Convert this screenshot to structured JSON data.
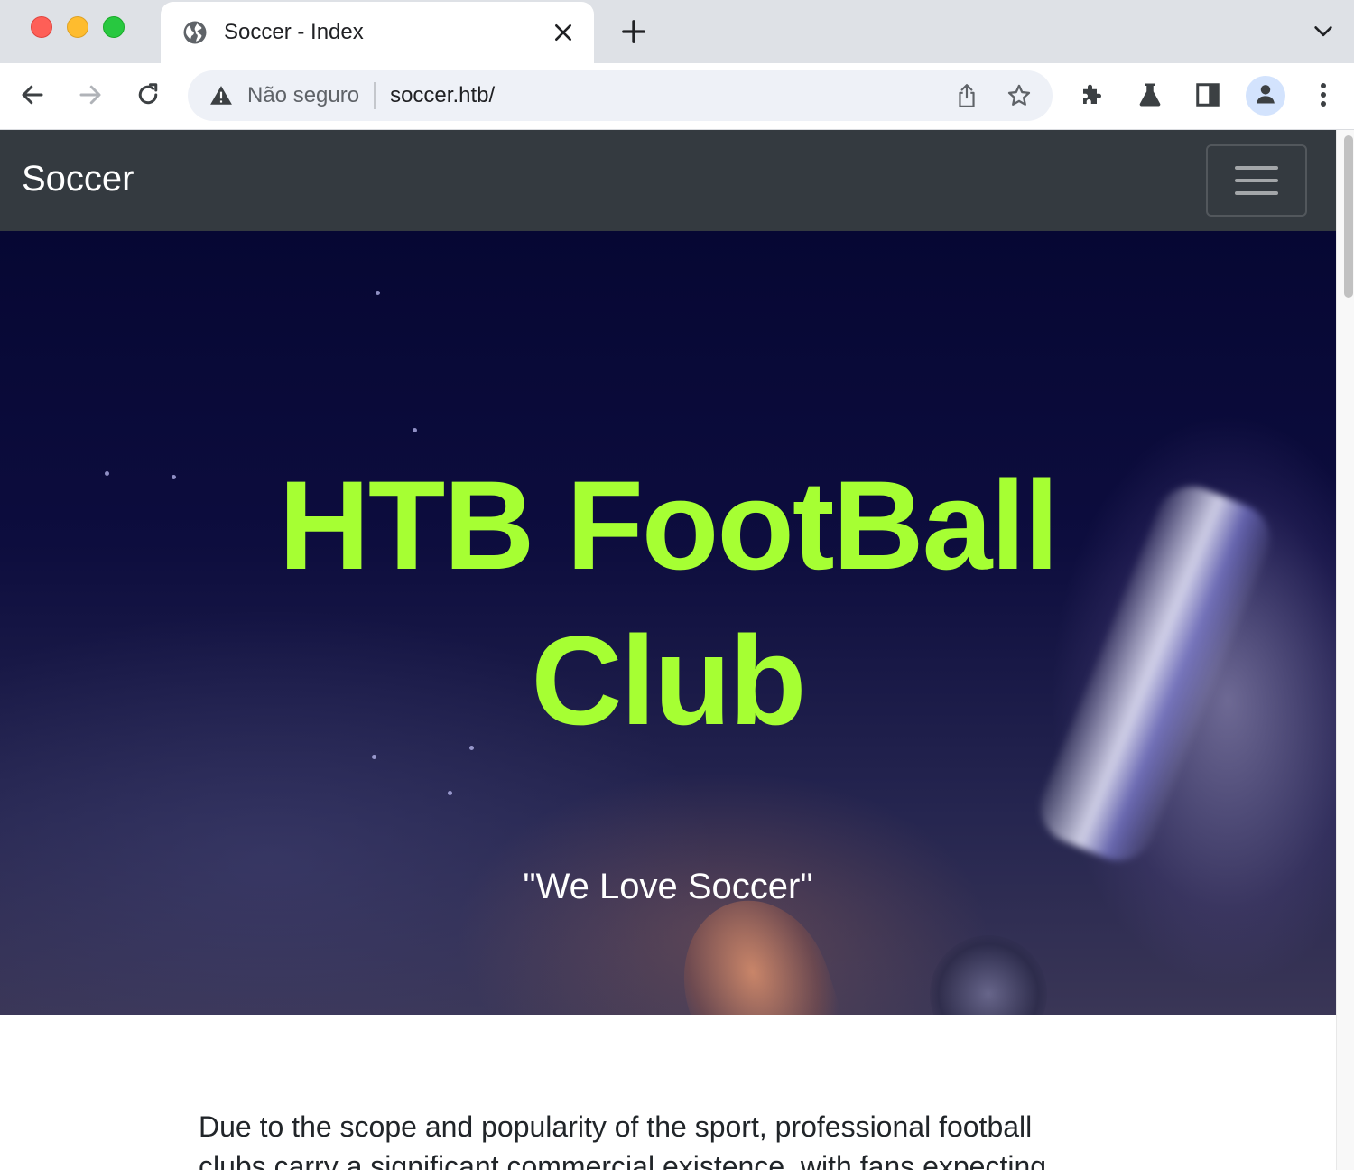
{
  "browser": {
    "tab": {
      "title": "Soccer - Index",
      "favicon": "globe-icon"
    },
    "omnibox": {
      "security_label": "Não seguro",
      "url": "soccer.htb/"
    },
    "icons": {
      "back": "back-arrow-icon",
      "forward": "forward-arrow-icon",
      "reload": "reload-icon",
      "share": "share-icon",
      "bookmark": "star-icon",
      "extensions": "puzzle-icon",
      "labs": "flask-icon",
      "sidepanel": "side-panel-icon",
      "profile": "profile-icon",
      "menu": "kebab-menu-icon"
    }
  },
  "page": {
    "navbar": {
      "brand": "Soccer",
      "toggler_icon": "hamburger-icon"
    },
    "hero": {
      "title": "HTB FootBall Club",
      "subtitle": "\"We Love Soccer\""
    },
    "content": {
      "paragraph": "Due to the scope and popularity of the sport, professional football clubs carry a significant commercial existence, with fans expecting"
    }
  },
  "colors": {
    "navbar_bg": "#343a40",
    "hero_title": "#a6ff33",
    "tabstrip_bg": "#dee1e6",
    "omnibox_bg": "#eef1f7"
  }
}
